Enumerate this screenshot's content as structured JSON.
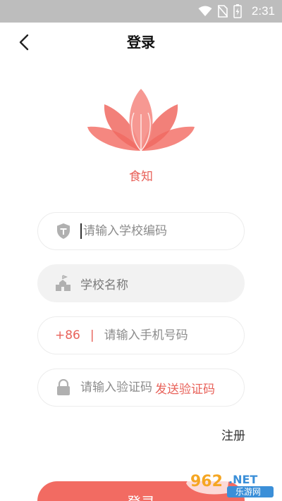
{
  "status_bar": {
    "time": "2:31"
  },
  "header": {
    "title": "登录"
  },
  "brand": {
    "name": "食知"
  },
  "form": {
    "school_code": {
      "placeholder": "请输入学校编码",
      "value": ""
    },
    "school_name": {
      "label": "学校名称"
    },
    "phone": {
      "prefix": "+86",
      "separator": "|",
      "placeholder": "请输入手机号码",
      "value": ""
    },
    "verify_code": {
      "placeholder": "请输入验证码",
      "value": "",
      "send_label": "发送验证码"
    }
  },
  "register_label": "注册",
  "login_label": "登录",
  "watermark": {
    "main": "962.NET",
    "sub": "乐游网"
  },
  "colors": {
    "accent": "#e8625a",
    "button": "#f26b62",
    "status_bar": "#bdbdbd"
  }
}
